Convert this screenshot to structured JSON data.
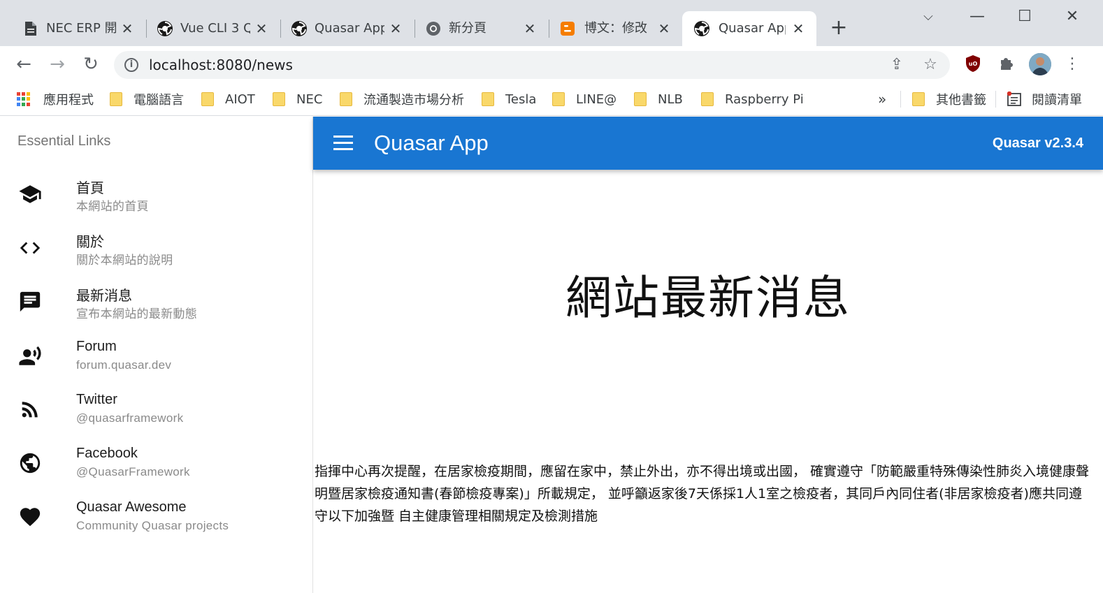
{
  "browser": {
    "tabs": [
      {
        "title": "NEC ERP 開",
        "icon": "document-icon",
        "active": false
      },
      {
        "title": "Vue CLI 3 Q",
        "icon": "quasar-icon",
        "active": false
      },
      {
        "title": "Quasar App",
        "icon": "quasar-icon",
        "active": false
      },
      {
        "title": "新分頁",
        "icon": "chrome-icon",
        "active": false
      },
      {
        "title": "博文：修改",
        "icon": "blogger-icon",
        "active": false
      },
      {
        "title": "Quasar App",
        "icon": "quasar-icon",
        "active": true
      }
    ],
    "url": "localhost:8080/news",
    "bookmarks": [
      {
        "label": "應用程式",
        "icon": "apps-grid-icon"
      },
      {
        "label": "電腦語言",
        "icon": "folder-icon"
      },
      {
        "label": "AIOT",
        "icon": "folder-icon"
      },
      {
        "label": "NEC",
        "icon": "folder-icon"
      },
      {
        "label": "流通製造市場分析",
        "icon": "folder-icon"
      },
      {
        "label": "Tesla",
        "icon": "folder-icon"
      },
      {
        "label": "LINE@",
        "icon": "folder-icon"
      },
      {
        "label": "NLB",
        "icon": "folder-icon"
      },
      {
        "label": "Raspberry Pi",
        "icon": "folder-icon"
      }
    ],
    "bookmarks_overflow": "»",
    "other_bookmarks": "其他書籤",
    "reading_list": "閱讀清單"
  },
  "drawer": {
    "header": "Essential Links",
    "links": [
      {
        "title": "首頁",
        "caption": "本網站的首頁",
        "icon": "school-icon"
      },
      {
        "title": "關於",
        "caption": "關於本網站的說明",
        "icon": "code-icon"
      },
      {
        "title": "最新消息",
        "caption": "宣布本網站的最新動態",
        "icon": "chat-icon"
      },
      {
        "title": "Forum",
        "caption": "forum.quasar.dev",
        "icon": "record-voice-icon"
      },
      {
        "title": "Twitter",
        "caption": "@quasarframework",
        "icon": "rss-feed-icon"
      },
      {
        "title": "Facebook",
        "caption": "@QuasarFramework",
        "icon": "public-icon"
      },
      {
        "title": "Quasar Awesome",
        "caption": "Community Quasar projects",
        "icon": "favorite-icon"
      }
    ]
  },
  "header": {
    "title": "Quasar App",
    "version": "Quasar v2.3.4"
  },
  "main": {
    "heading": "網站最新消息",
    "body": "指揮中心再次提醒，在居家檢疫期間，應留在家中，禁止外出，亦不得出境或出國， 確實遵守「防範嚴重特殊傳染性肺炎入境健康聲明暨居家檢疫通知書(春節檢疫專案)」所載規定， 並呼籲返家後7天係採1人1室之檢疫者，其同戶內同住者(非居家檢疫者)應共同遵守以下加強暨 自主健康管理相關規定及檢測措施"
  },
  "colors": {
    "brand": "#1976d2",
    "tabstrip": "#dee1e6",
    "folder": "#f9d86a"
  }
}
